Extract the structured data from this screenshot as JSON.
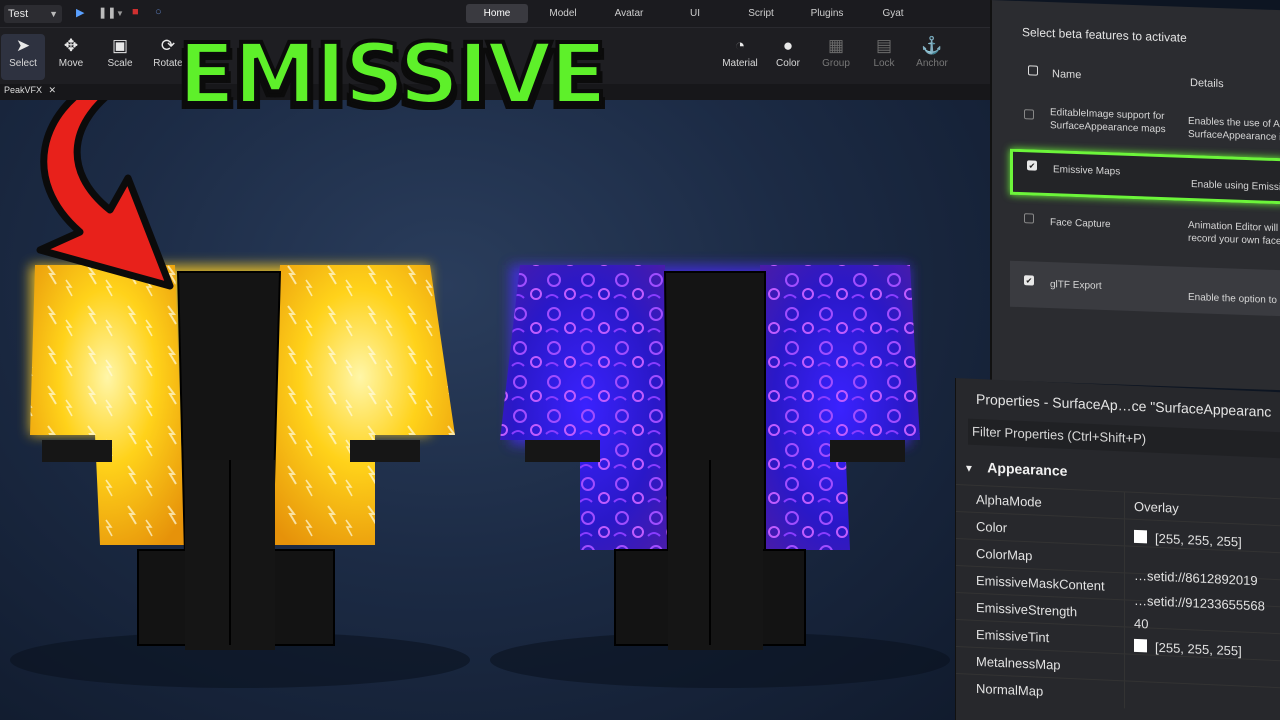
{
  "topbar": {
    "mode": "Test",
    "tabs": [
      {
        "label": "Home",
        "active": true
      },
      {
        "label": "Model"
      },
      {
        "label": "Avatar"
      },
      {
        "label": "UI"
      },
      {
        "label": "Script"
      },
      {
        "label": "Plugins"
      },
      {
        "label": "Gyat"
      }
    ]
  },
  "toolbar": {
    "tools": [
      {
        "label": "Select",
        "icon": "cursor-icon"
      },
      {
        "label": "Move",
        "icon": "move-icon"
      },
      {
        "label": "Scale",
        "icon": "scale-icon"
      },
      {
        "label": "Rotate",
        "icon": "rotate-icon"
      },
      {
        "label": "Material",
        "icon": "material-icon"
      },
      {
        "label": "Color",
        "icon": "color-icon"
      },
      {
        "label": "Group",
        "icon": "group-icon"
      },
      {
        "label": "Lock",
        "icon": "lock-icon"
      },
      {
        "label": "Anchor",
        "icon": "anchor-icon"
      }
    ]
  },
  "file_tab": {
    "label": "PeakVFX"
  },
  "title": "EMISSIVE",
  "beta": {
    "heading": "Select beta features to activate",
    "col_name": "Name",
    "col_details": "Details",
    "features": [
      {
        "name": "EditableImage support for SurfaceAppearance maps",
        "details": "Enables the use of A SurfaceAppearance i",
        "checked": false
      },
      {
        "name": "Emissive Maps",
        "details": "Enable using Emissive",
        "checked": true
      },
      {
        "name": "Face Capture",
        "details": "Animation Editor will record your own face",
        "checked": false
      },
      {
        "name": "glTF Export",
        "details": "Enable the option to ex",
        "checked": true
      }
    ]
  },
  "properties": {
    "title": "Properties - SurfaceAp…ce \"SurfaceAppearanc",
    "filter": "Filter Properties (Ctrl+Shift+P)",
    "section": "Appearance",
    "rows": [
      {
        "name": "AlphaMode",
        "value": "Overlay"
      },
      {
        "name": "Color",
        "value": "[255, 255, 255]",
        "swatch": "#ffffff"
      },
      {
        "name": "ColorMap",
        "value": ""
      },
      {
        "name": "EmissiveMaskContent",
        "value": "…setid://8612892019"
      },
      {
        "name": "EmissiveStrength",
        "value": "…setid://91233655568"
      },
      {
        "name": "EmissiveTint",
        "value": "40"
      },
      {
        "name": "MetalnessMap",
        "value": "[255, 255, 255]",
        "swatch": "#ffffff"
      },
      {
        "name": "NormalMap",
        "value": ""
      }
    ]
  },
  "colors": {
    "accent_green": "#5ef02a",
    "arrow_red": "#e8211b",
    "gold": "#ffd21a",
    "purple": "#5a2bff"
  }
}
